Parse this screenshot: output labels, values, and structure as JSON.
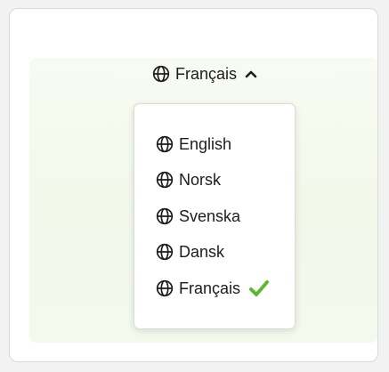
{
  "selector": {
    "current_label": "Français",
    "expanded_icon": "chevron-up-icon"
  },
  "menu": {
    "items": [
      {
        "label": "English",
        "icon": "globe-icon",
        "selected": false
      },
      {
        "label": "Norsk",
        "icon": "globe-icon",
        "selected": false
      },
      {
        "label": "Svenska",
        "icon": "globe-icon",
        "selected": false
      },
      {
        "label": "Dansk",
        "icon": "globe-icon",
        "selected": false
      },
      {
        "label": "Français",
        "icon": "globe-icon",
        "selected": true
      }
    ],
    "selected_icon": "checkmark-icon"
  },
  "colors": {
    "check": "#5cb82d",
    "text": "#1c1c1c",
    "panel_tint": "#f2f8ea"
  }
}
